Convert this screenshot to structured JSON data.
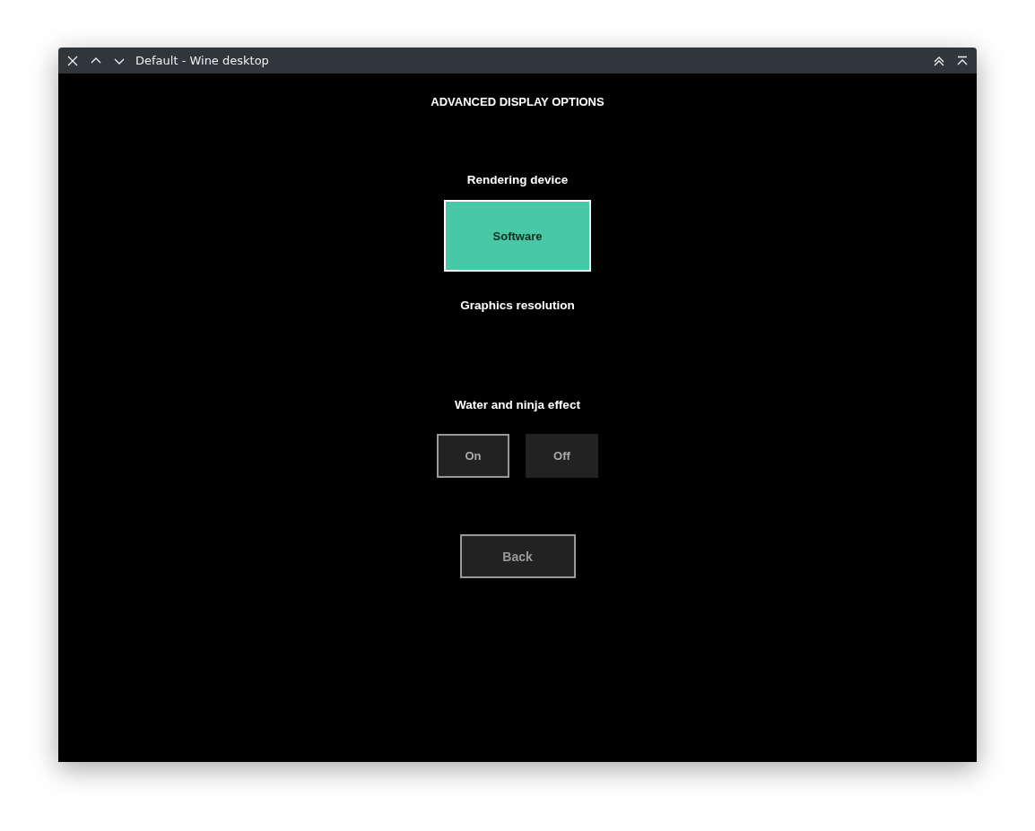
{
  "window": {
    "title": "Default - Wine desktop"
  },
  "heading": "ADVANCED DISPLAY OPTIONS",
  "rendering_device": {
    "label": "Rendering device",
    "options": [
      {
        "label": "Software",
        "selected": true
      }
    ]
  },
  "graphics_resolution": {
    "label": "Graphics resolution"
  },
  "water_effect": {
    "label": "Water and ninja effect",
    "options": [
      {
        "label": "On",
        "selected": true
      },
      {
        "label": "Off",
        "selected": false
      }
    ]
  },
  "back_button": "Back"
}
